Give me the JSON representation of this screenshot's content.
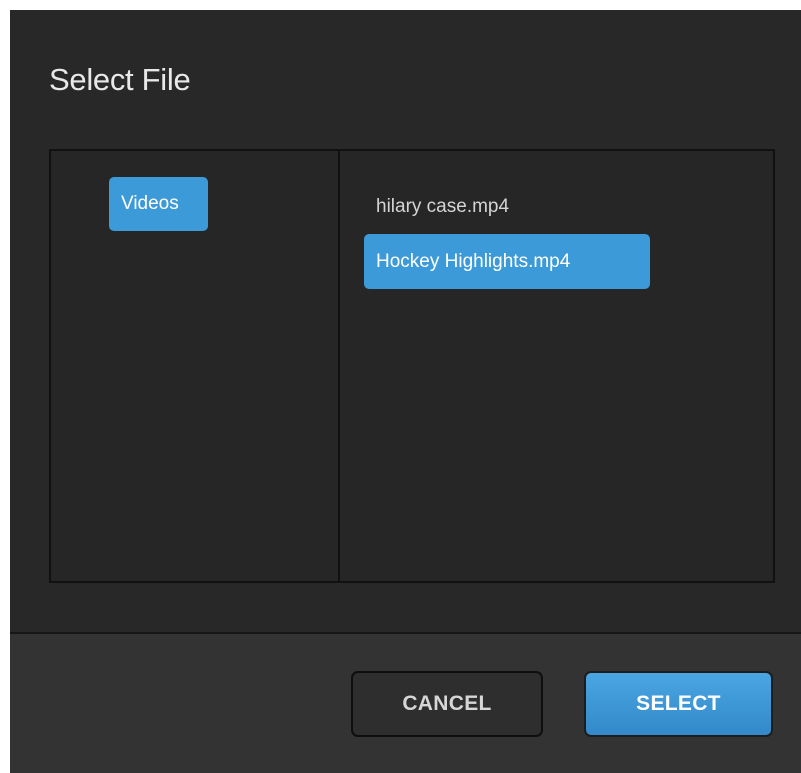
{
  "dialog": {
    "title": "Select File"
  },
  "folders": [
    {
      "label": "Videos",
      "selected": true
    }
  ],
  "files": [
    {
      "label": "hilary case.mp4",
      "selected": false
    },
    {
      "label": "Hockey Highlights.mp4",
      "selected": true
    }
  ],
  "buttons": {
    "cancel_label": "CANCEL",
    "select_label": "SELECT"
  },
  "colors": {
    "accent": "#3d9ad8",
    "background": "#282828",
    "footer": "#333333"
  }
}
